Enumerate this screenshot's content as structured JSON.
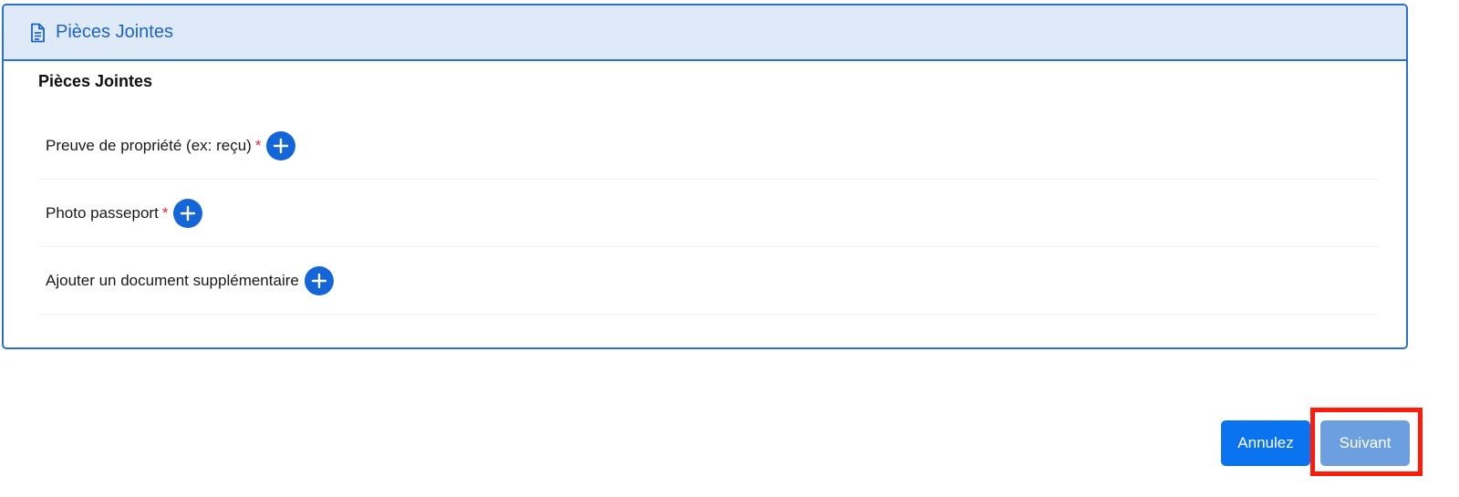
{
  "panel": {
    "header_title": "Pièces Jointes",
    "header_icon": "document-icon",
    "section_title": "Pièces Jointes",
    "border_color": "#2a6fd1",
    "header_bg": "#deeaf7"
  },
  "attachments": [
    {
      "label": "Preuve de propriété (ex: reçu)",
      "required": "*",
      "action_icon": "plus-circle-icon"
    },
    {
      "label": "Photo passeport",
      "required": "*",
      "action_icon": "plus-circle-icon"
    },
    {
      "label": "Ajouter un document supplémentaire",
      "required": "",
      "action_icon": "plus-circle-icon"
    }
  ],
  "actions": {
    "cancel_label": "Annulez",
    "next_label": "Suivant",
    "cancel_color": "#0a74f0",
    "next_color": "#6c9fe0",
    "highlight_color": "#ff1a0a"
  }
}
